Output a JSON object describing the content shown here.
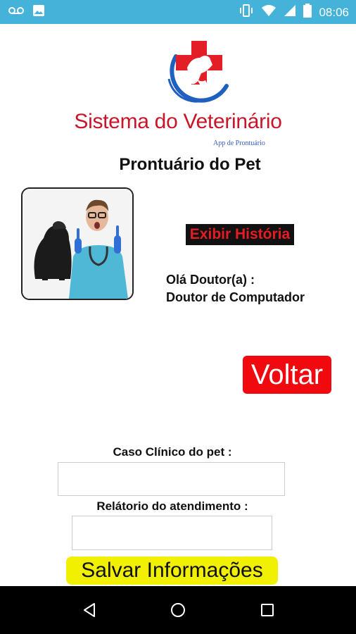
{
  "status_bar": {
    "time": "08:06",
    "icons": [
      "voicemail-icon",
      "image-icon",
      "vibrate-icon",
      "wifi-icon",
      "signal-icon",
      "battery-icon"
    ]
  },
  "header": {
    "brand_title": "Sistema do Veterinário",
    "brand_subtitle": "App de Prontuário",
    "logo_colors": {
      "cross": "#e41e26",
      "ring": "#1f5fbf"
    }
  },
  "page": {
    "title": "Prontuário do Pet",
    "history_button": "Exibir História",
    "greeting": "Olá Doutor(a) :",
    "doctor_name": "Doutor de Computador",
    "back_button": "Voltar"
  },
  "form": {
    "caso_label": "Caso Clínico do pet :",
    "caso_value": "",
    "relatorio_label": "Relátorio do atendimento :",
    "relatorio_value": "",
    "save_button": "Salvar Informações"
  },
  "nav_bar": {
    "icons": [
      "back-triangle-icon",
      "home-circle-icon",
      "recents-square-icon"
    ]
  },
  "colors": {
    "status_bar": "#44b2d9",
    "brand_red": "#c8152a",
    "history_bg": "#111111",
    "history_text": "#e51c23",
    "back_bg": "#f00a10",
    "save_bg": "#f0f000"
  }
}
